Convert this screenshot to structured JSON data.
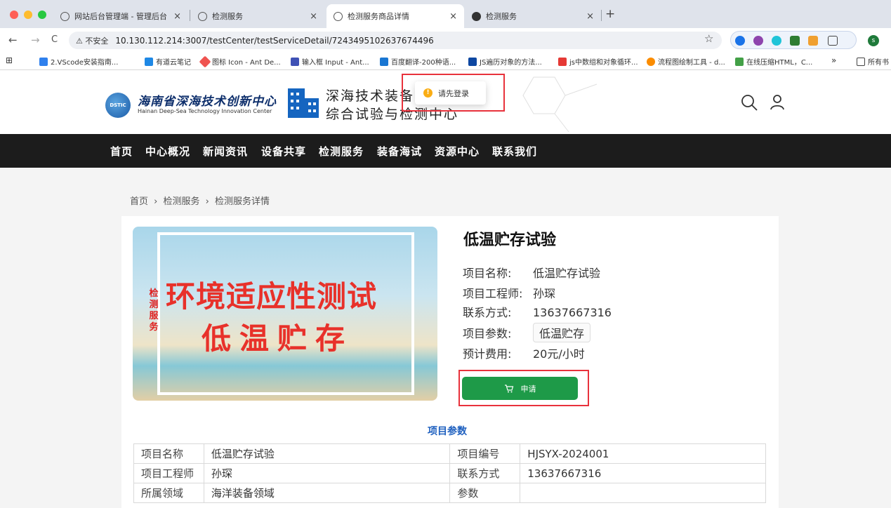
{
  "browser": {
    "tabs": [
      {
        "title": "网站后台管理端 - 管理后台",
        "active": false
      },
      {
        "title": "检测服务",
        "active": false
      },
      {
        "title": "检测服务商品详情",
        "active": true
      },
      {
        "title": "检测服务",
        "active": false
      }
    ],
    "new_tab": "+",
    "close_glyph": "×",
    "nav": {
      "back": "←",
      "forward": "→",
      "reload": "C"
    },
    "security_label": "⚠ 不安全",
    "url": "10.130.112.214:3007/testCenter/testServiceDetail/7243495102637674496",
    "star": "☆",
    "profile": "s",
    "bookmarks": [
      "2.VScode安装指南...",
      "有道云笔记",
      "图标 Icon - Ant De...",
      "输入框 Input - Ant...",
      "百度翻译-200种语...",
      "JS遍历对象的方法...",
      "js中数组和对象循环...",
      "流程图绘制工具 - d...",
      "在线压缩HTML，C..."
    ],
    "bookmarks_more": "»",
    "bookmarks_all": "所有书"
  },
  "header": {
    "logo_badge": "DSTIC",
    "logo_cn": "海南省深海技术创新中心",
    "logo_en": "Hainan Deep-Sea Technology Innovation Center",
    "subtitle_line1": "深海技术装备",
    "subtitle_line2": "综合试验与检测中心",
    "toast": "请先登录"
  },
  "nav_items": [
    "首页",
    "中心概况",
    "新闻资讯",
    "设备共享",
    "检测服务",
    "装备海试",
    "资源中心",
    "联系我们"
  ],
  "breadcrumb": {
    "home": "首页",
    "sep": "›",
    "section": "检测服务",
    "current": "检测服务详情"
  },
  "banner": {
    "vertical": "检测服务",
    "line1": "环境适应性测试",
    "line2": "低温贮存"
  },
  "product": {
    "title": "低温贮存试验",
    "fields": [
      {
        "label": "项目名称:",
        "value": "低温贮存试验"
      },
      {
        "label": "项目工程师:",
        "value": "孙琛"
      },
      {
        "label": "联系方式:",
        "value": "13637667316"
      },
      {
        "label": "项目参数:",
        "value": "低温贮存"
      },
      {
        "label": "预计费用:",
        "value": "20元/小时"
      }
    ],
    "apply": "申请"
  },
  "params": {
    "title": "项目参数",
    "rows": [
      [
        "项目名称",
        "低温贮存试验",
        "项目编号",
        "HJSYX-2024001"
      ],
      [
        "项目工程师",
        "孙琛",
        "联系方式",
        "13637667316"
      ],
      [
        "所属领域",
        "海洋装备领域",
        "参数",
        ""
      ]
    ]
  },
  "colors": {
    "primary": "#1e9a48",
    "nav_bg": "#1c1c1c",
    "accent_blue": "#1d5fbf",
    "highlight": "#e8323c"
  }
}
